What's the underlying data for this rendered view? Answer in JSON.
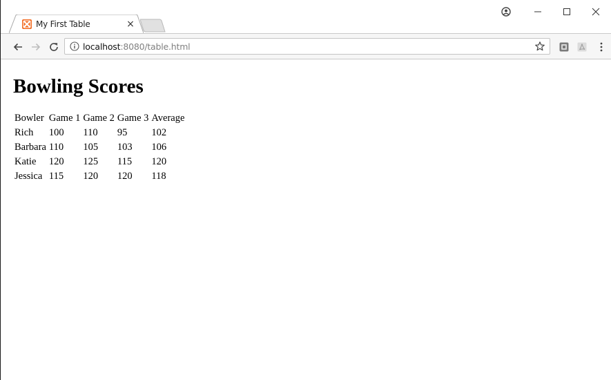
{
  "browser": {
    "tab": {
      "title": "My First Table",
      "close_glyph": "×",
      "favicon": "xampp-icon",
      "favicon_color": "#f26b22"
    },
    "window_controls": {
      "profile": "profile-icon",
      "minimize": "minimize-icon",
      "maximize": "maximize-icon",
      "close": "close-icon"
    },
    "toolbar": {
      "back": "back-arrow-icon",
      "forward": "forward-arrow-icon",
      "reload": "reload-icon",
      "url_host": "localhost",
      "url_rest": ":8080/table.html",
      "bookmark": "star-icon",
      "extensions": [
        "extension-icon",
        "pdf-extension-icon"
      ],
      "menu": "kebab-menu-icon"
    }
  },
  "page": {
    "heading": "Bowling Scores",
    "table": {
      "headers": [
        "Bowler",
        "Game 1",
        "Game 2",
        "Game 3",
        "Average"
      ],
      "rows": [
        [
          "Rich",
          "100",
          "110",
          "95",
          "102"
        ],
        [
          "Barbara",
          "110",
          "105",
          "103",
          "106"
        ],
        [
          "Katie",
          "120",
          "125",
          "115",
          "120"
        ],
        [
          "Jessica",
          "115",
          "120",
          "120",
          "118"
        ]
      ]
    }
  }
}
